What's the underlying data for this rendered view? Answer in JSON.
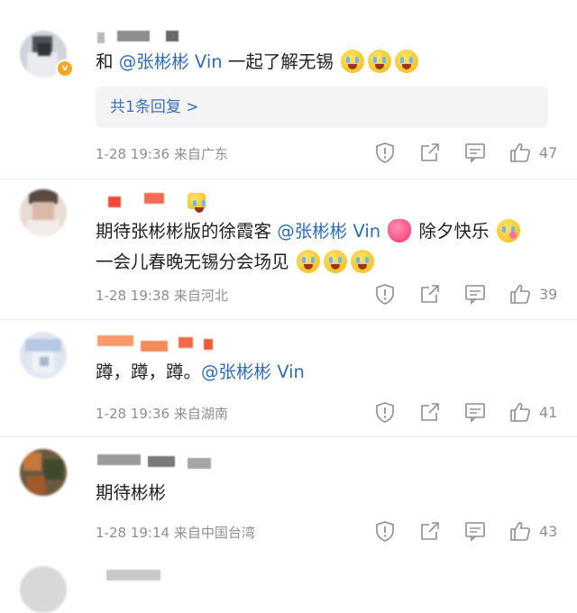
{
  "comments": [
    {
      "text_prefix": "和",
      "mention": "@张彬彬 Vin",
      "text_after": "一起了解无锡",
      "replies_label": "共1条回复 >",
      "time": "1-28 19:36",
      "location": "来自广东",
      "likes": "47"
    },
    {
      "line1_prefix": "期待张彬彬版的徐霞客",
      "mention": "@张彬彬 Vin",
      "line1_suffix": "除夕快乐",
      "line2": "一会儿春晚无锡分会场见",
      "time": "1-28 19:38",
      "location": "来自河北",
      "likes": "39"
    },
    {
      "text_prefix": "蹲，蹲，蹲。",
      "mention": "@张彬彬 Vin",
      "time": "1-28 19:36",
      "location": "来自湖南",
      "likes": "41"
    },
    {
      "text": "期待彬彬",
      "time": "1-28 19:14",
      "location": "来自中国台湾",
      "likes": "43"
    }
  ],
  "icons": {
    "report": "report-icon",
    "share": "share-icon",
    "reply": "comment-icon",
    "like": "thumbs-up-icon"
  },
  "colors": {
    "mention": "#2f6bb3",
    "meta": "#8e8e93",
    "reply_box": "#f4f4f6"
  }
}
